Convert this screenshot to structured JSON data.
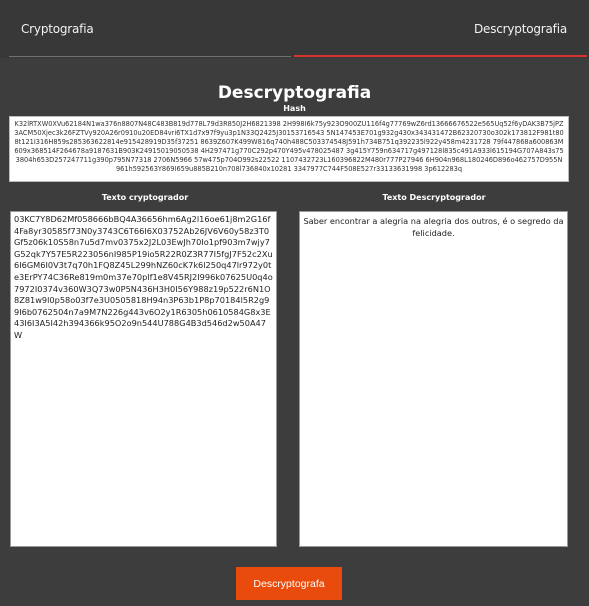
{
  "nav": {
    "tab_encrypt": "Cryptografia",
    "tab_decrypt": "Descryptografia"
  },
  "main": {
    "title": "Descryptografia",
    "hash_label": "Hash",
    "hash_value": "K32lRTXW0XVu62184N1wa376n8807N48C483B819d778L79d3R850J2H6821398 2H998I6k75y923O900ZU116f4g77769wZ6rd13666676522e565Uq52f6yDAK3B75jPZ3ACM50Xjec3k26FZTVy920A26r0910u20ED84vri6TX1d7x97f9yu3p1N33Q2425J30153716543 5N147453E701g932g430x343431472B62320730o302k173812F981t808t121I316H859s285363622814e915428919D35f37251 8639Z607K499W816q740h488C503374548J591h734B751q392235l922y458m4231728 79f447868a600863M609x368514F264678a9187631B903K24915019050538 4H297471g770C292p470Y495v478025487 3g415Y759n634717g497128l835c491A933l615194G707A843s753804h653D257247711g390p795N77318 2706N5966 57w475p704O992s22522 1107432723L160396822M480r777P27946 6H904n968L180246D896o462757D955N961h592563Y869I659u885B210n708l736840x10281 3347977C744F508E527r33133631998 3p612283q"
  },
  "labels": {
    "encrypted_text": "Texto cryptogrador",
    "decrypted_text": "Texto Descryptogrador"
  },
  "fields": {
    "encrypted_value": "03KC7Y8D62Mf058666bBQ4A36656hm6Ag2l16oe61j8m2G16f4Fa8yr30585f73N0y3743C6T66I6X03752Ab26JV6V60y58z3T0Gf5z06k10S58n7u5d7mv0375x2J2L03EwJh70Io1pf903m7wjy7G52qk7Y57E5R223056nI985P19io5R22R0Z3R77I5fgJ7F52c2Xu6I6GM6I0V3t7q70h1FQ8Z45L299hNZ60cK7k6l250q47lr972y0te3ErPY74C36Re819m0m37e70plf1e8V45RJ2I996k07625U0q4o7972I0374v360W3Q73w0P5N436H3H0I56Y988z19p522r6N1O8Z81w9l0p58o03f7e3U0505818H94n3P63b1P8p70184l5R2g99I6b0762504n7a9M7N226g443v6O2y1R6305h0610584G8x3E43I6I3A5I42h394366k95O2o9n544U788G4B3d546d2w50A47W",
    "decrypted_value": "Saber encontrar a alegria na alegria dos outros, é o segredo da felicidade."
  },
  "actions": {
    "decrypt_button": "Descryptografa"
  }
}
